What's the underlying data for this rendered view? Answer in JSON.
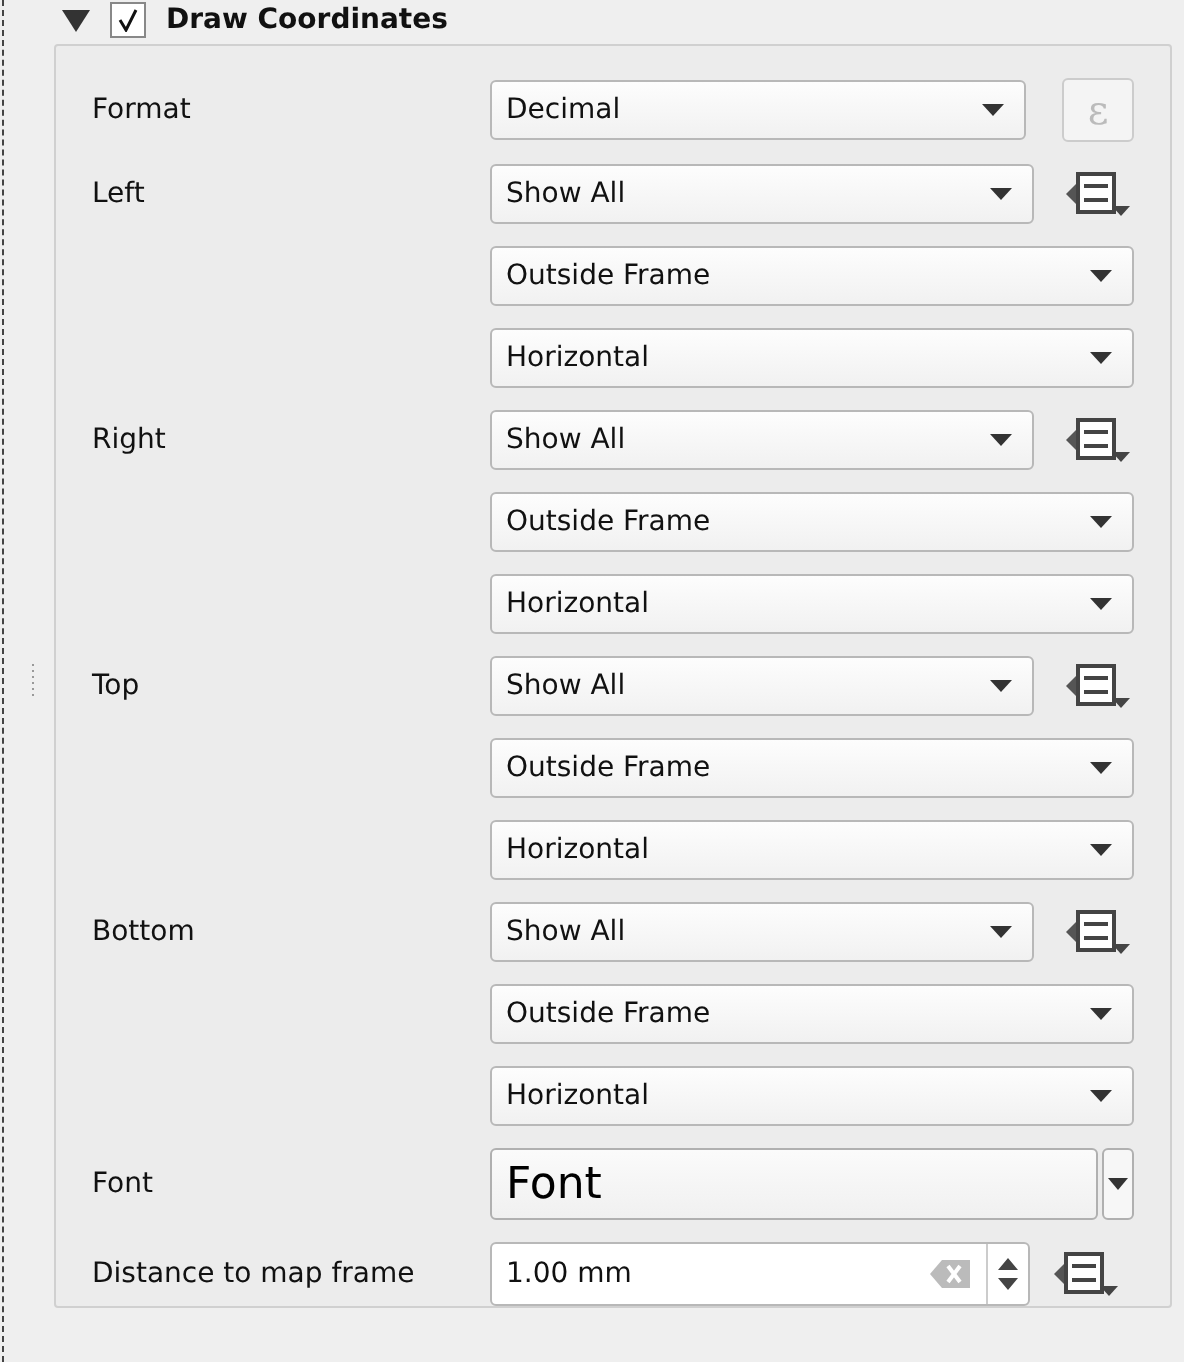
{
  "group": {
    "title": "Draw Coordinates",
    "expanded": true,
    "checked": true
  },
  "format": {
    "label": "Format",
    "value": "Decimal",
    "expression_button": {
      "label": "ε",
      "disabled": true
    }
  },
  "sides": [
    {
      "label": "Left",
      "display": "Show All",
      "position": "Outside Frame",
      "direction": "Horizontal"
    },
    {
      "label": "Right",
      "display": "Show All",
      "position": "Outside Frame",
      "direction": "Horizontal"
    },
    {
      "label": "Top",
      "display": "Show All",
      "position": "Outside Frame",
      "direction": "Horizontal"
    },
    {
      "label": "Bottom",
      "display": "Show All",
      "position": "Outside Frame",
      "direction": "Horizontal"
    }
  ],
  "font": {
    "label": "Font",
    "value": "Font"
  },
  "distance": {
    "label": "Distance to map frame",
    "value": "1.00 mm"
  }
}
